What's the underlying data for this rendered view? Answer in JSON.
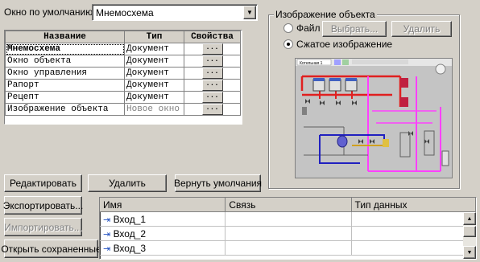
{
  "default_window": {
    "label": "Окно по умолчанию :",
    "value": "Мнемосхема"
  },
  "window_table": {
    "headers": [
      "Название",
      "Тип",
      "Свойства"
    ],
    "rows": [
      {
        "name": "Мнемосхема",
        "type": "Документ",
        "props": "..."
      },
      {
        "name": "Окно объекта",
        "type": "Документ",
        "props": "..."
      },
      {
        "name": "Окно управления",
        "type": "Документ",
        "props": "..."
      },
      {
        "name": "Рапорт",
        "type": "Документ",
        "props": "..."
      },
      {
        "name": "Рецепт",
        "type": "Документ",
        "props": "..."
      },
      {
        "name": "Изображение объекта",
        "type": "Новое окно",
        "props": "..."
      }
    ]
  },
  "object_image": {
    "group_label": "Изображение объекта",
    "file_radio": "Файл",
    "choose_button": "Выбрать...",
    "delete_button": "Удалить",
    "compressed_radio": "Сжатое изображение",
    "preview_title": "Котельная 1"
  },
  "actions": {
    "edit": "Редактировать",
    "delete": "Удалить",
    "restore_defaults": "Вернуть умолчания",
    "export": "Экспортировать...",
    "import": "Импортировать...",
    "open_saved": "Открыть сохраненные"
  },
  "io_table": {
    "headers": [
      "Имя",
      "Связь",
      "Тип данных"
    ],
    "rows": [
      {
        "name": "Вход_1",
        "link": "",
        "type": ""
      },
      {
        "name": "Вход_2",
        "link": "",
        "type": ""
      },
      {
        "name": "Вход_3",
        "link": "",
        "type": ""
      }
    ]
  }
}
